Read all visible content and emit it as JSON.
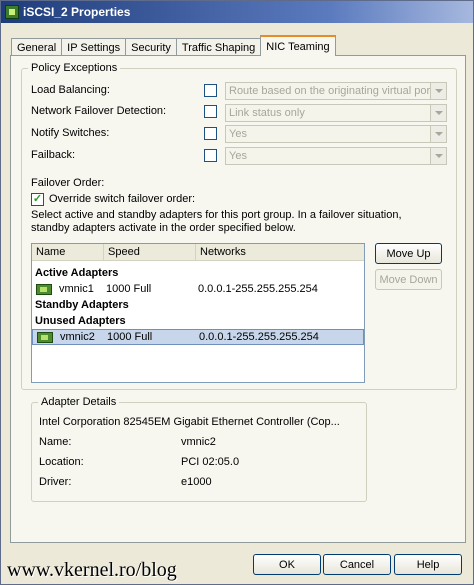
{
  "window": {
    "title": "iSCSI_2 Properties"
  },
  "tabs": [
    "General",
    "IP Settings",
    "Security",
    "Traffic Shaping",
    "NIC Teaming"
  ],
  "policy": {
    "legend": "Policy Exceptions",
    "rows": [
      {
        "label": "Load Balancing:",
        "checked": false,
        "value": "Route based on the originating virtual port ID"
      },
      {
        "label": "Network Failover Detection:",
        "checked": false,
        "value": "Link status only"
      },
      {
        "label": "Notify Switches:",
        "checked": false,
        "value": "Yes"
      },
      {
        "label": "Failback:",
        "checked": false,
        "value": "Yes"
      }
    ],
    "failover_label": "Failover Order:",
    "override_label": "Override switch failover order:",
    "override_checked": true,
    "description": "Select active and standby adapters for this port group.  In a failover situation, standby adapters activate  in the order specified below."
  },
  "adapters": {
    "columns": [
      "Name",
      "Speed",
      "Networks"
    ],
    "groups": {
      "active": "Active Adapters",
      "standby": "Standby Adapters",
      "unused": "Unused Adapters"
    },
    "active": [
      {
        "name": "vmnic1",
        "speed": "1000 Full",
        "networks": "0.0.0.1-255.255.255.254"
      }
    ],
    "unused": [
      {
        "name": "vmnic2",
        "speed": "1000 Full",
        "networks": "0.0.0.1-255.255.255.254"
      }
    ],
    "move_up": "Move Up",
    "move_down": "Move Down"
  },
  "details": {
    "legend": "Adapter Details",
    "description": "Intel Corporation 82545EM Gigabit Ethernet Controller (Cop...",
    "name_label": "Name:",
    "name_value": "vmnic2",
    "location_label": "Location:",
    "location_value": "PCI 02:05.0",
    "driver_label": "Driver:",
    "driver_value": "e1000"
  },
  "footer": {
    "ok": "OK",
    "cancel": "Cancel",
    "help": "Help",
    "watermark": "www.vkernel.ro/blog"
  }
}
